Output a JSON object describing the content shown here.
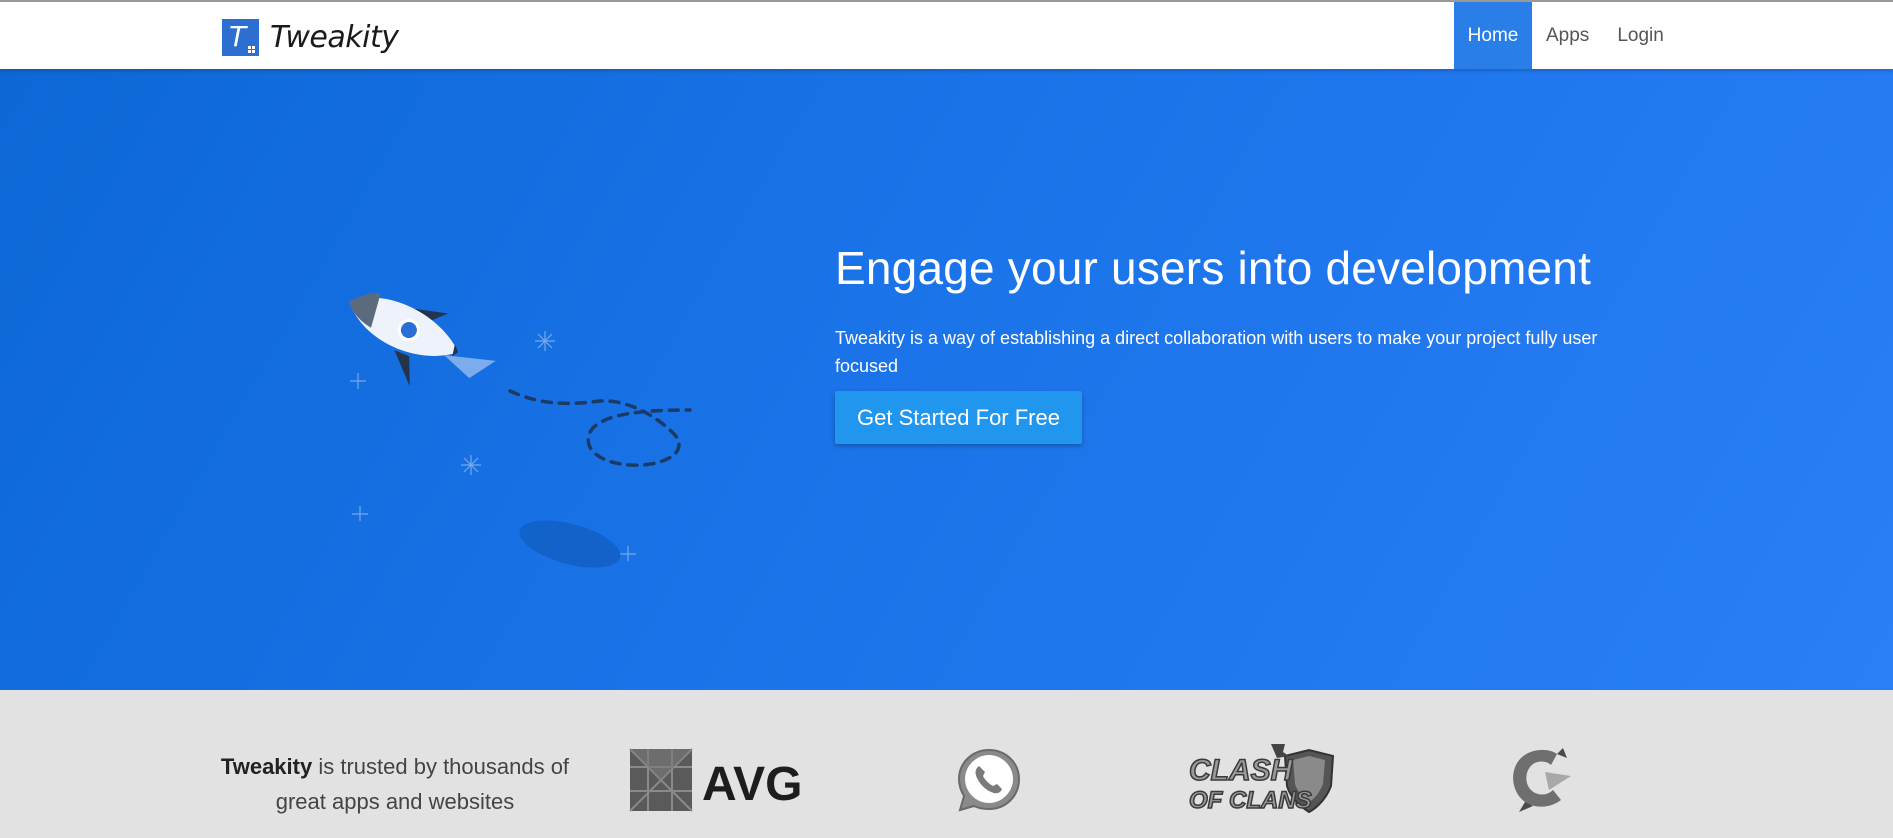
{
  "navbar": {
    "brand_name": "Tweakity",
    "brand_letter": "T",
    "items": [
      {
        "label": "Home",
        "active": true
      },
      {
        "label": "Apps",
        "active": false
      },
      {
        "label": "Login",
        "active": false
      }
    ]
  },
  "hero": {
    "title": "Engage your users into development",
    "description": "Tweakity is a way of establishing a direct collaboration with users to make your project fully user focused",
    "cta_label": "Get Started For Free"
  },
  "trusted": {
    "brand": "Tweakity",
    "text_rest": " is trusted by thousands of great apps and websites",
    "logos": [
      {
        "name": "avg-logo",
        "text": "AVG"
      },
      {
        "name": "whatsapp-logo",
        "icon": "phone-handset-icon"
      },
      {
        "name": "clash-of-clans-logo",
        "text_line1": "CLASH",
        "text_line2": "OF CLANS"
      },
      {
        "name": "ccleaner-logo",
        "icon": "ccleaner-icon"
      }
    ]
  },
  "colors": {
    "hero_start": "#0d68d6",
    "hero_end": "#2a7ef6",
    "nav_active": "#2a7ee8",
    "cta": "#2196ee",
    "strip": "#e2e2e2"
  }
}
